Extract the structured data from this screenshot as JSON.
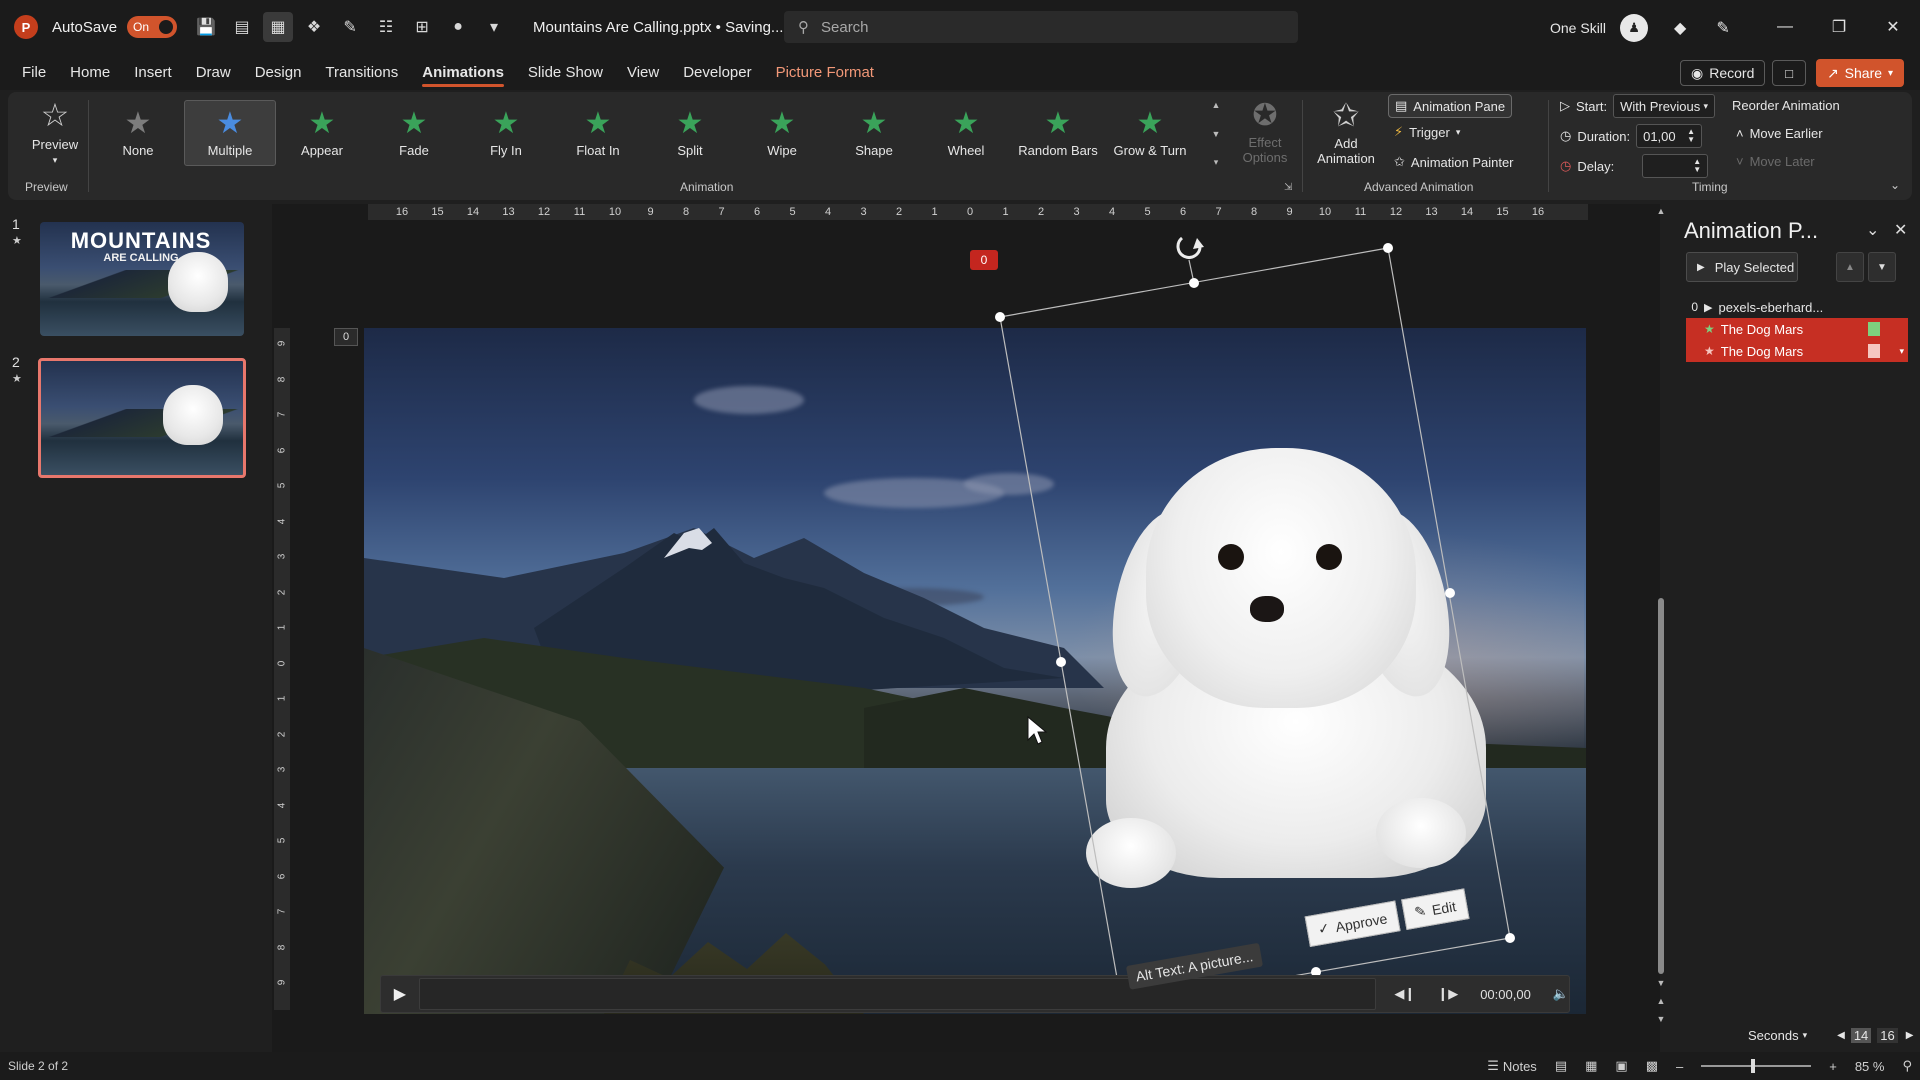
{
  "titlebar": {
    "autosave_label": "AutoSave",
    "autosave_state": "On",
    "document_title": "Mountains Are Calling.pptx • Saving...",
    "search_placeholder": "Search",
    "user_name": "One Skill",
    "icons": [
      "save-icon",
      "slideshow-icon",
      "layout-icon",
      "draw-icon",
      "pen-icon",
      "present-icon",
      "format-icon",
      "shapes-icon",
      "more-icon"
    ]
  },
  "tabs": [
    {
      "label": "File"
    },
    {
      "label": "Home"
    },
    {
      "label": "Insert"
    },
    {
      "label": "Draw"
    },
    {
      "label": "Design"
    },
    {
      "label": "Transitions"
    },
    {
      "label": "Animations",
      "active": true
    },
    {
      "label": "Slide Show"
    },
    {
      "label": "View"
    },
    {
      "label": "Developer"
    },
    {
      "label": "Picture Format",
      "contextual": true
    }
  ],
  "header_buttons": {
    "record": "Record",
    "share": "Share"
  },
  "ribbon": {
    "preview": {
      "label": "Preview",
      "group": "Preview"
    },
    "animation_group": "Animation",
    "animations": [
      {
        "label": "None",
        "color": "#7c7c7c"
      },
      {
        "label": "Multiple",
        "color": "#4a8ce0",
        "selected": true
      },
      {
        "label": "Appear",
        "color": "#3aa35a"
      },
      {
        "label": "Fade",
        "color": "#3aa35a"
      },
      {
        "label": "Fly In",
        "color": "#3aa35a"
      },
      {
        "label": "Float In",
        "color": "#3aa35a"
      },
      {
        "label": "Split",
        "color": "#3aa35a"
      },
      {
        "label": "Wipe",
        "color": "#3aa35a"
      },
      {
        "label": "Shape",
        "color": "#3aa35a"
      },
      {
        "label": "Wheel",
        "color": "#3aa35a"
      },
      {
        "label": "Random Bars",
        "color": "#3aa35a"
      },
      {
        "label": "Grow & Turn",
        "color": "#3aa35a"
      }
    ],
    "effect_options": "Effect Options",
    "add_animation": "Add Animation",
    "advanced": {
      "group": "Advanced Animation",
      "animation_pane": "Animation Pane",
      "trigger": "Trigger",
      "animation_painter": "Animation Painter"
    },
    "timing": {
      "group": "Timing",
      "start_label": "Start:",
      "start_value": "With Previous",
      "duration_label": "Duration:",
      "duration_value": "01,00",
      "delay_label": "Delay:",
      "delay_value": "",
      "reorder": "Reorder Animation",
      "move_earlier": "Move Earlier",
      "move_later": "Move Later"
    }
  },
  "slides": [
    {
      "number": "1",
      "title": "MOUNTAINS",
      "subtitle": "ARE CALLING"
    },
    {
      "number": "2",
      "selected": true
    }
  ],
  "editor": {
    "ruler_h": [
      "16",
      "15",
      "14",
      "13",
      "12",
      "11",
      "10",
      "9",
      "8",
      "7",
      "6",
      "5",
      "4",
      "3",
      "2",
      "1",
      "0",
      "1",
      "2",
      "3",
      "4",
      "5",
      "6",
      "7",
      "8",
      "9",
      "10",
      "11",
      "12",
      "13",
      "14",
      "15",
      "16"
    ],
    "ruler_v": [
      "9",
      "8",
      "7",
      "6",
      "5",
      "4",
      "3",
      "2",
      "1",
      "0",
      "1",
      "2",
      "3",
      "4",
      "5",
      "6",
      "7",
      "8",
      "9"
    ],
    "animation_tag": "0",
    "slide_tag": "0",
    "alt_text": "Alt Text: A picture...",
    "approve": "Approve",
    "edit": "Edit",
    "media_time": "00:00,00"
  },
  "animation_pane": {
    "title": "Animation P...",
    "play_selected": "Play Selected",
    "items": [
      {
        "num": "0",
        "label": "pexels-eberhard...",
        "highlight": false
      },
      {
        "num": "",
        "label": "The Dog Mars",
        "highlight": true,
        "bar_color": "#7ed07e"
      },
      {
        "num": "",
        "label": "The Dog Mars",
        "highlight": true,
        "bar_color": "#f5c6c0"
      }
    ],
    "units": "Seconds",
    "timeline_a": "14",
    "timeline_b": "16"
  },
  "status": {
    "slide_info": "Slide 2 of 2",
    "notes": "Notes",
    "zoom": "85 %"
  }
}
